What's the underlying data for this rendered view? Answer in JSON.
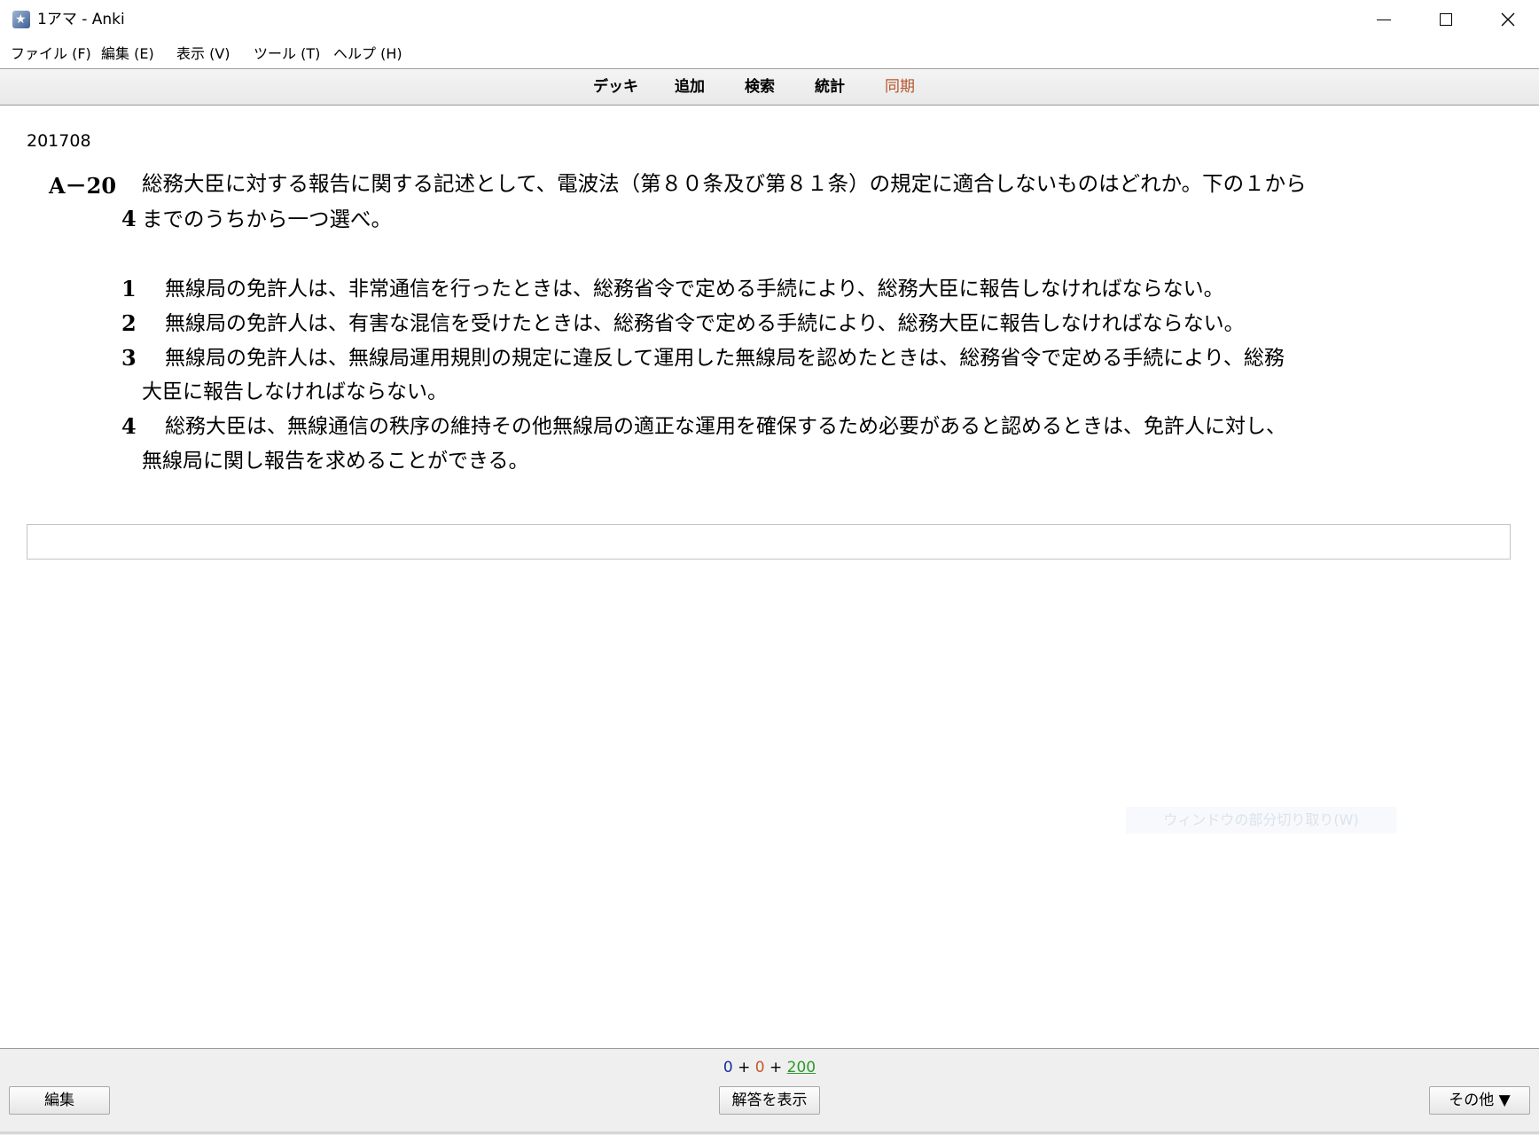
{
  "window": {
    "title": "1アマ - Anki",
    "icon": "anki-star-icon"
  },
  "menu": {
    "items": [
      {
        "label": "ファイル (F)"
      },
      {
        "label": "編集 (E)"
      },
      {
        "label": "表示 (V)"
      },
      {
        "label": "ツール (T)"
      },
      {
        "label": "ヘルプ (H)"
      }
    ]
  },
  "toolbar": {
    "links": [
      {
        "label": "デッキ"
      },
      {
        "label": "追加"
      },
      {
        "label": "検索"
      },
      {
        "label": "統計"
      },
      {
        "label": "同期"
      }
    ],
    "sync_color": "#b5542a"
  },
  "card": {
    "deck_id": "201708",
    "question_number": "A－20",
    "question_line1": "総務大臣に対する報告に関する記述として、電波法（第８０条及び第８１条）の規定に適合しないものはどれか。下の１から",
    "question_line2_num": "4",
    "question_line2": "までのうちから一つ選べ。",
    "options": [
      {
        "num": "1",
        "lines": [
          "無線局の免許人は、非常通信を行ったときは、総務省令で定める手続により、総務大臣に報告しなければならない。"
        ]
      },
      {
        "num": "2",
        "lines": [
          "無線局の免許人は、有害な混信を受けたときは、総務省令で定める手続により、総務大臣に報告しなければならない。"
        ]
      },
      {
        "num": "3",
        "lines": [
          "無線局の免許人は、無線局運用規則の規定に違反して運用した無線局を認めたときは、総務省令で定める手続により、総務",
          "大臣に報告しなければならない。"
        ]
      },
      {
        "num": "4",
        "lines": [
          "総務大臣は、無線通信の秩序の維持その他無線局の適正な運用を確保するため必要があると認めるときは、免許人に対し、",
          "無線局に関し報告を求めることができる。"
        ]
      }
    ],
    "answer_input_value": "",
    "watermark_text": "ウィンドウの部分切り取り(W)"
  },
  "status": {
    "new_count": "0",
    "learn_count": "0",
    "review_count": "200",
    "plus": "+",
    "colors": {
      "new": "#1a2d9c",
      "learn": "#c3592a",
      "review": "#2b9b2b"
    }
  },
  "buttons": {
    "edit": "編集",
    "show_answer": "解答を表示",
    "more": "その他 ▼"
  }
}
